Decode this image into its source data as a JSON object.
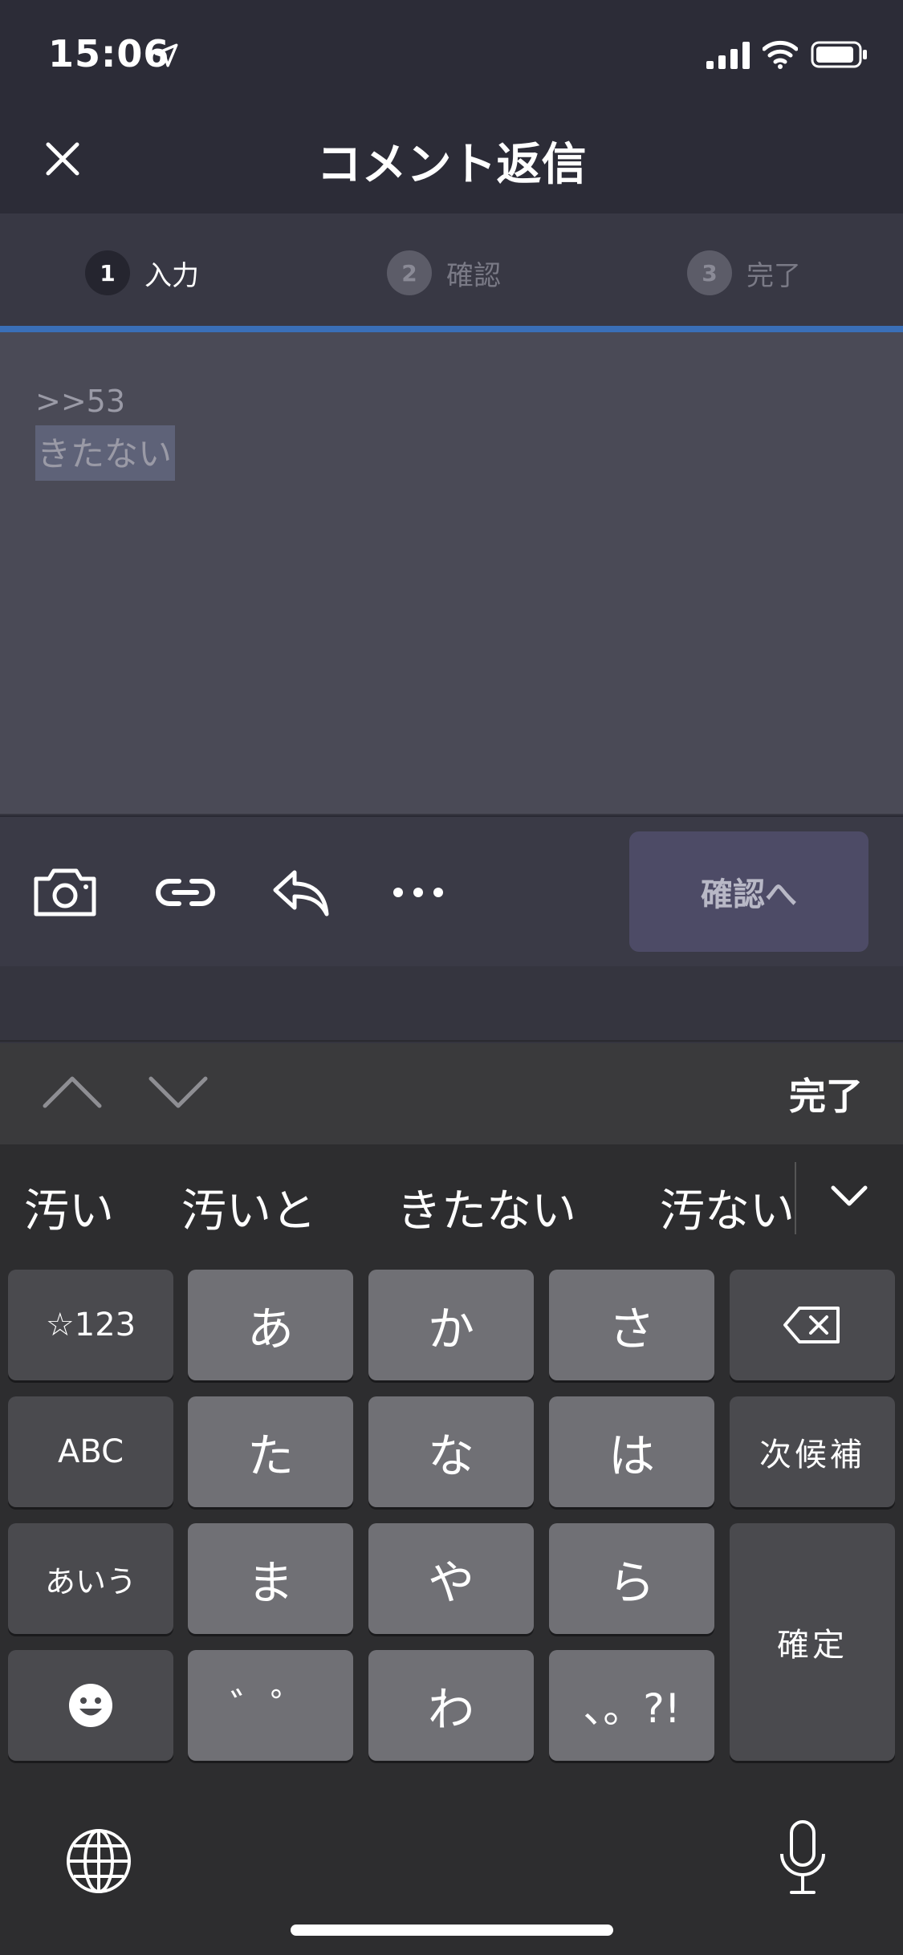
{
  "status_bar": {
    "time": "15:06"
  },
  "nav": {
    "title": "コメント返信"
  },
  "steps": [
    {
      "num": "1",
      "label": "入力"
    },
    {
      "num": "2",
      "label": "確認"
    },
    {
      "num": "3",
      "label": "完了"
    }
  ],
  "editor": {
    "reply_ref": ">>53",
    "text": "きたない"
  },
  "toolbar": {
    "confirm_label": "確認へ"
  },
  "keyboard": {
    "done_label": "完了",
    "candidates": [
      "汚い",
      "汚いと",
      "きたない",
      "汚ない"
    ],
    "keys": {
      "row1": [
        "☆123",
        "あ",
        "か",
        "さ"
      ],
      "row2": [
        "ABC",
        "た",
        "な",
        "は",
        "次候補"
      ],
      "row3": [
        "あいう",
        "ま",
        "や",
        "ら",
        "確定"
      ],
      "row4": [
        "゛゜",
        "わ",
        "、。?!"
      ]
    }
  },
  "colors": {
    "accent": "#3a6fb8",
    "background": "#35353f",
    "text_area": "#4a4a56",
    "confirm_button": "#4d4b66"
  }
}
